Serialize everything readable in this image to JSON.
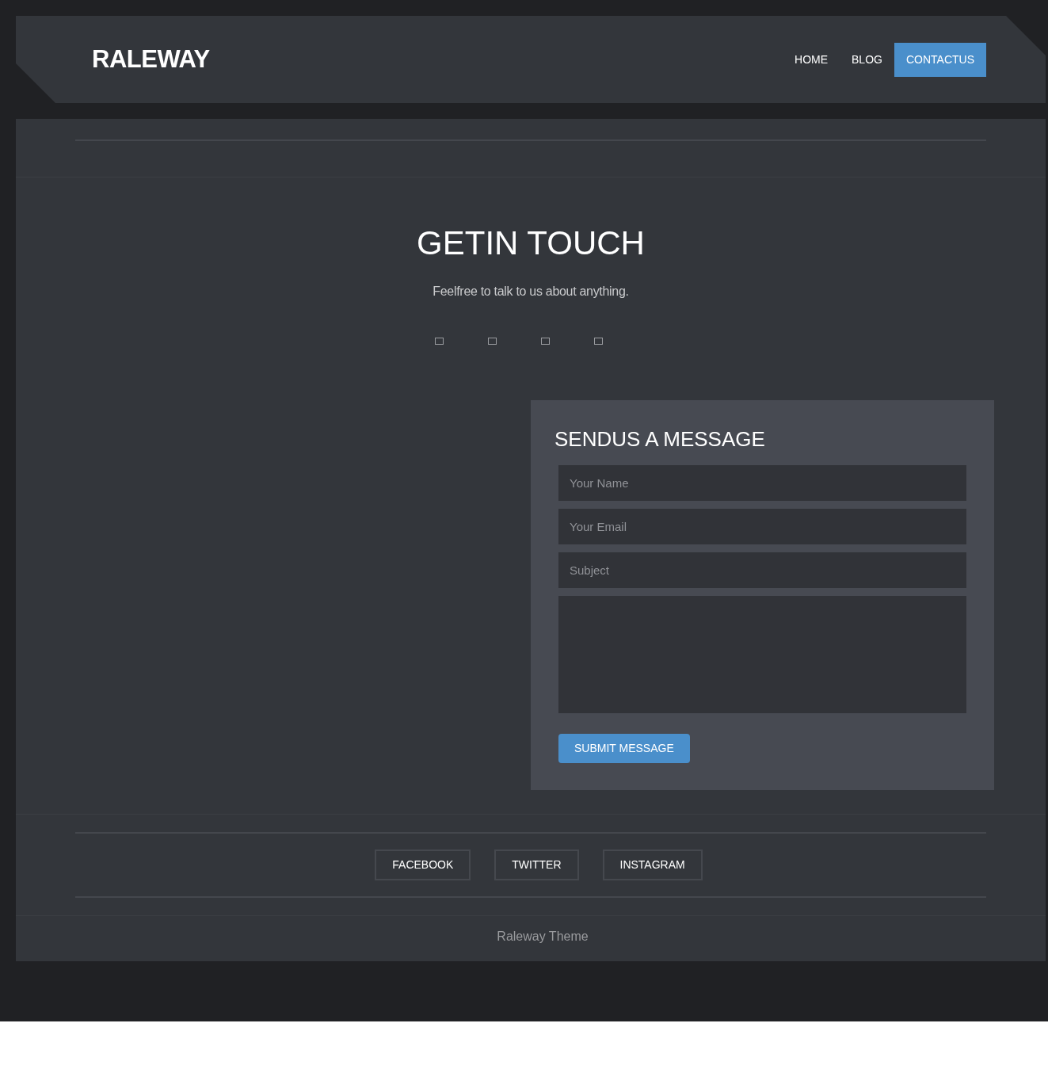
{
  "header": {
    "logo": "RALEWAY",
    "nav": [
      {
        "label": "HOME",
        "selected": false
      },
      {
        "label": "BLOG",
        "selected": false
      },
      {
        "label": "CONTACTUS",
        "selected": true
      }
    ]
  },
  "intro": {
    "title": "GETIN TOUCH",
    "subtitle": "Feelfree to talk to us about anything.",
    "icons": [
      {
        "kind": "square"
      },
      {
        "kind": "square"
      },
      {
        "kind": "square"
      },
      {
        "kind": "square"
      }
    ]
  },
  "form": {
    "title": "SENDUS A MESSAGE",
    "fields": [
      {
        "kind": "input",
        "placeholder": "Your Name"
      },
      {
        "kind": "input",
        "placeholder": "Your Email"
      },
      {
        "kind": "input",
        "placeholder": "Subject"
      },
      {
        "kind": "textarea"
      }
    ],
    "submit": "SUBMIT MESSAGE"
  },
  "social": [
    "FACEBOOK",
    "TWITTER",
    "INSTAGRAM"
  ],
  "footer": {
    "text": "Raleway Theme"
  }
}
